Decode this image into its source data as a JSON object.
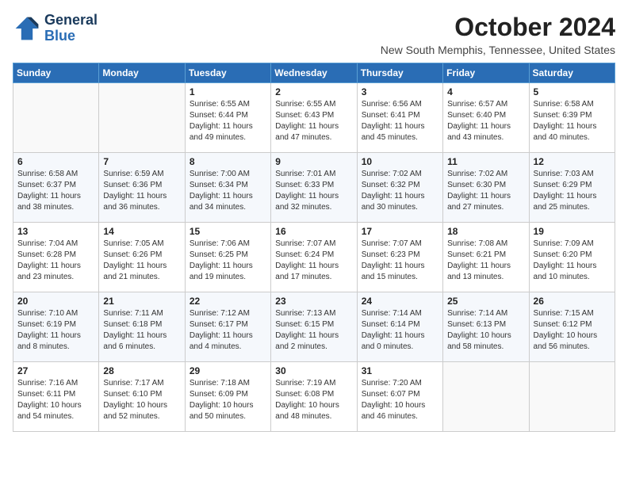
{
  "header": {
    "logo_line1": "General",
    "logo_line2": "Blue",
    "month_title": "October 2024",
    "location": "New South Memphis, Tennessee, United States"
  },
  "days_of_week": [
    "Sunday",
    "Monday",
    "Tuesday",
    "Wednesday",
    "Thursday",
    "Friday",
    "Saturday"
  ],
  "weeks": [
    [
      {
        "day": "",
        "info": ""
      },
      {
        "day": "",
        "info": ""
      },
      {
        "day": "1",
        "info": "Sunrise: 6:55 AM\nSunset: 6:44 PM\nDaylight: 11 hours and 49 minutes."
      },
      {
        "day": "2",
        "info": "Sunrise: 6:55 AM\nSunset: 6:43 PM\nDaylight: 11 hours and 47 minutes."
      },
      {
        "day": "3",
        "info": "Sunrise: 6:56 AM\nSunset: 6:41 PM\nDaylight: 11 hours and 45 minutes."
      },
      {
        "day": "4",
        "info": "Sunrise: 6:57 AM\nSunset: 6:40 PM\nDaylight: 11 hours and 43 minutes."
      },
      {
        "day": "5",
        "info": "Sunrise: 6:58 AM\nSunset: 6:39 PM\nDaylight: 11 hours and 40 minutes."
      }
    ],
    [
      {
        "day": "6",
        "info": "Sunrise: 6:58 AM\nSunset: 6:37 PM\nDaylight: 11 hours and 38 minutes."
      },
      {
        "day": "7",
        "info": "Sunrise: 6:59 AM\nSunset: 6:36 PM\nDaylight: 11 hours and 36 minutes."
      },
      {
        "day": "8",
        "info": "Sunrise: 7:00 AM\nSunset: 6:34 PM\nDaylight: 11 hours and 34 minutes."
      },
      {
        "day": "9",
        "info": "Sunrise: 7:01 AM\nSunset: 6:33 PM\nDaylight: 11 hours and 32 minutes."
      },
      {
        "day": "10",
        "info": "Sunrise: 7:02 AM\nSunset: 6:32 PM\nDaylight: 11 hours and 30 minutes."
      },
      {
        "day": "11",
        "info": "Sunrise: 7:02 AM\nSunset: 6:30 PM\nDaylight: 11 hours and 27 minutes."
      },
      {
        "day": "12",
        "info": "Sunrise: 7:03 AM\nSunset: 6:29 PM\nDaylight: 11 hours and 25 minutes."
      }
    ],
    [
      {
        "day": "13",
        "info": "Sunrise: 7:04 AM\nSunset: 6:28 PM\nDaylight: 11 hours and 23 minutes."
      },
      {
        "day": "14",
        "info": "Sunrise: 7:05 AM\nSunset: 6:26 PM\nDaylight: 11 hours and 21 minutes."
      },
      {
        "day": "15",
        "info": "Sunrise: 7:06 AM\nSunset: 6:25 PM\nDaylight: 11 hours and 19 minutes."
      },
      {
        "day": "16",
        "info": "Sunrise: 7:07 AM\nSunset: 6:24 PM\nDaylight: 11 hours and 17 minutes."
      },
      {
        "day": "17",
        "info": "Sunrise: 7:07 AM\nSunset: 6:23 PM\nDaylight: 11 hours and 15 minutes."
      },
      {
        "day": "18",
        "info": "Sunrise: 7:08 AM\nSunset: 6:21 PM\nDaylight: 11 hours and 13 minutes."
      },
      {
        "day": "19",
        "info": "Sunrise: 7:09 AM\nSunset: 6:20 PM\nDaylight: 11 hours and 10 minutes."
      }
    ],
    [
      {
        "day": "20",
        "info": "Sunrise: 7:10 AM\nSunset: 6:19 PM\nDaylight: 11 hours and 8 minutes."
      },
      {
        "day": "21",
        "info": "Sunrise: 7:11 AM\nSunset: 6:18 PM\nDaylight: 11 hours and 6 minutes."
      },
      {
        "day": "22",
        "info": "Sunrise: 7:12 AM\nSunset: 6:17 PM\nDaylight: 11 hours and 4 minutes."
      },
      {
        "day": "23",
        "info": "Sunrise: 7:13 AM\nSunset: 6:15 PM\nDaylight: 11 hours and 2 minutes."
      },
      {
        "day": "24",
        "info": "Sunrise: 7:14 AM\nSunset: 6:14 PM\nDaylight: 11 hours and 0 minutes."
      },
      {
        "day": "25",
        "info": "Sunrise: 7:14 AM\nSunset: 6:13 PM\nDaylight: 10 hours and 58 minutes."
      },
      {
        "day": "26",
        "info": "Sunrise: 7:15 AM\nSunset: 6:12 PM\nDaylight: 10 hours and 56 minutes."
      }
    ],
    [
      {
        "day": "27",
        "info": "Sunrise: 7:16 AM\nSunset: 6:11 PM\nDaylight: 10 hours and 54 minutes."
      },
      {
        "day": "28",
        "info": "Sunrise: 7:17 AM\nSunset: 6:10 PM\nDaylight: 10 hours and 52 minutes."
      },
      {
        "day": "29",
        "info": "Sunrise: 7:18 AM\nSunset: 6:09 PM\nDaylight: 10 hours and 50 minutes."
      },
      {
        "day": "30",
        "info": "Sunrise: 7:19 AM\nSunset: 6:08 PM\nDaylight: 10 hours and 48 minutes."
      },
      {
        "day": "31",
        "info": "Sunrise: 7:20 AM\nSunset: 6:07 PM\nDaylight: 10 hours and 46 minutes."
      },
      {
        "day": "",
        "info": ""
      },
      {
        "day": "",
        "info": ""
      }
    ]
  ]
}
